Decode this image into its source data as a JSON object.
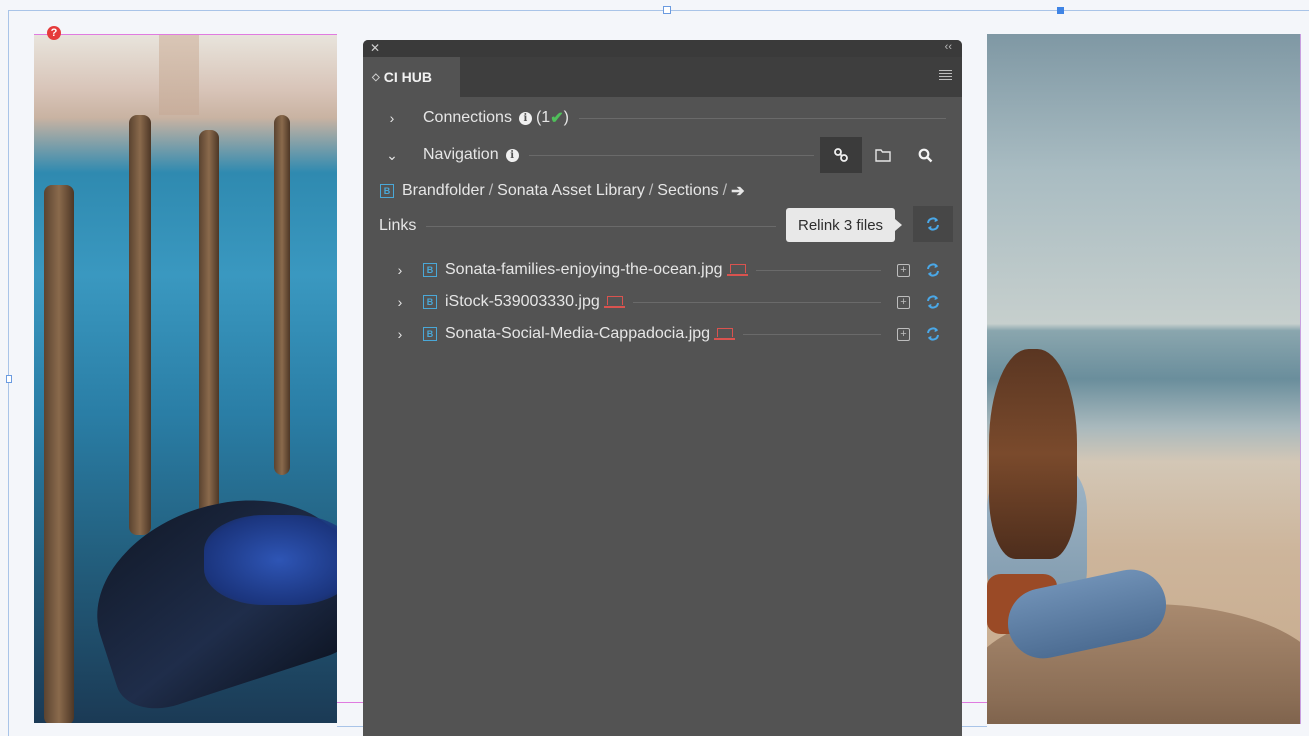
{
  "panel": {
    "tab_label": "CI HUB",
    "connections": {
      "label": "Connections",
      "count_text": "(1 ",
      "close_paren": ")"
    },
    "navigation": {
      "label": "Navigation"
    },
    "breadcrumb": [
      "Brandfolder",
      "Sonata Asset Library",
      "Sections"
    ],
    "links": {
      "label": "Links",
      "relink_tooltip": "Relink 3 files"
    },
    "files": [
      {
        "name": "Sonata-families-enjoying-the-ocean.jpg"
      },
      {
        "name": "iStock-539003330.jpg"
      },
      {
        "name": "Sonata-Social-Media-Cappadocia.jpg"
      }
    ]
  },
  "colors": {
    "panel_bg": "#535353",
    "accent_blue": "#4aa8d8",
    "missing_red": "#d9534f",
    "ok_green": "#4fbf5a"
  },
  "icons": [
    "close-icon",
    "collapse-icon",
    "panel-menu-icon",
    "info-icon",
    "checkmark-icon",
    "link-icon",
    "folder-icon",
    "search-icon",
    "brandfolder-icon",
    "arrow-right-icon",
    "sync-icon",
    "laptop-icon",
    "place-icon",
    "missing-link-icon"
  ]
}
